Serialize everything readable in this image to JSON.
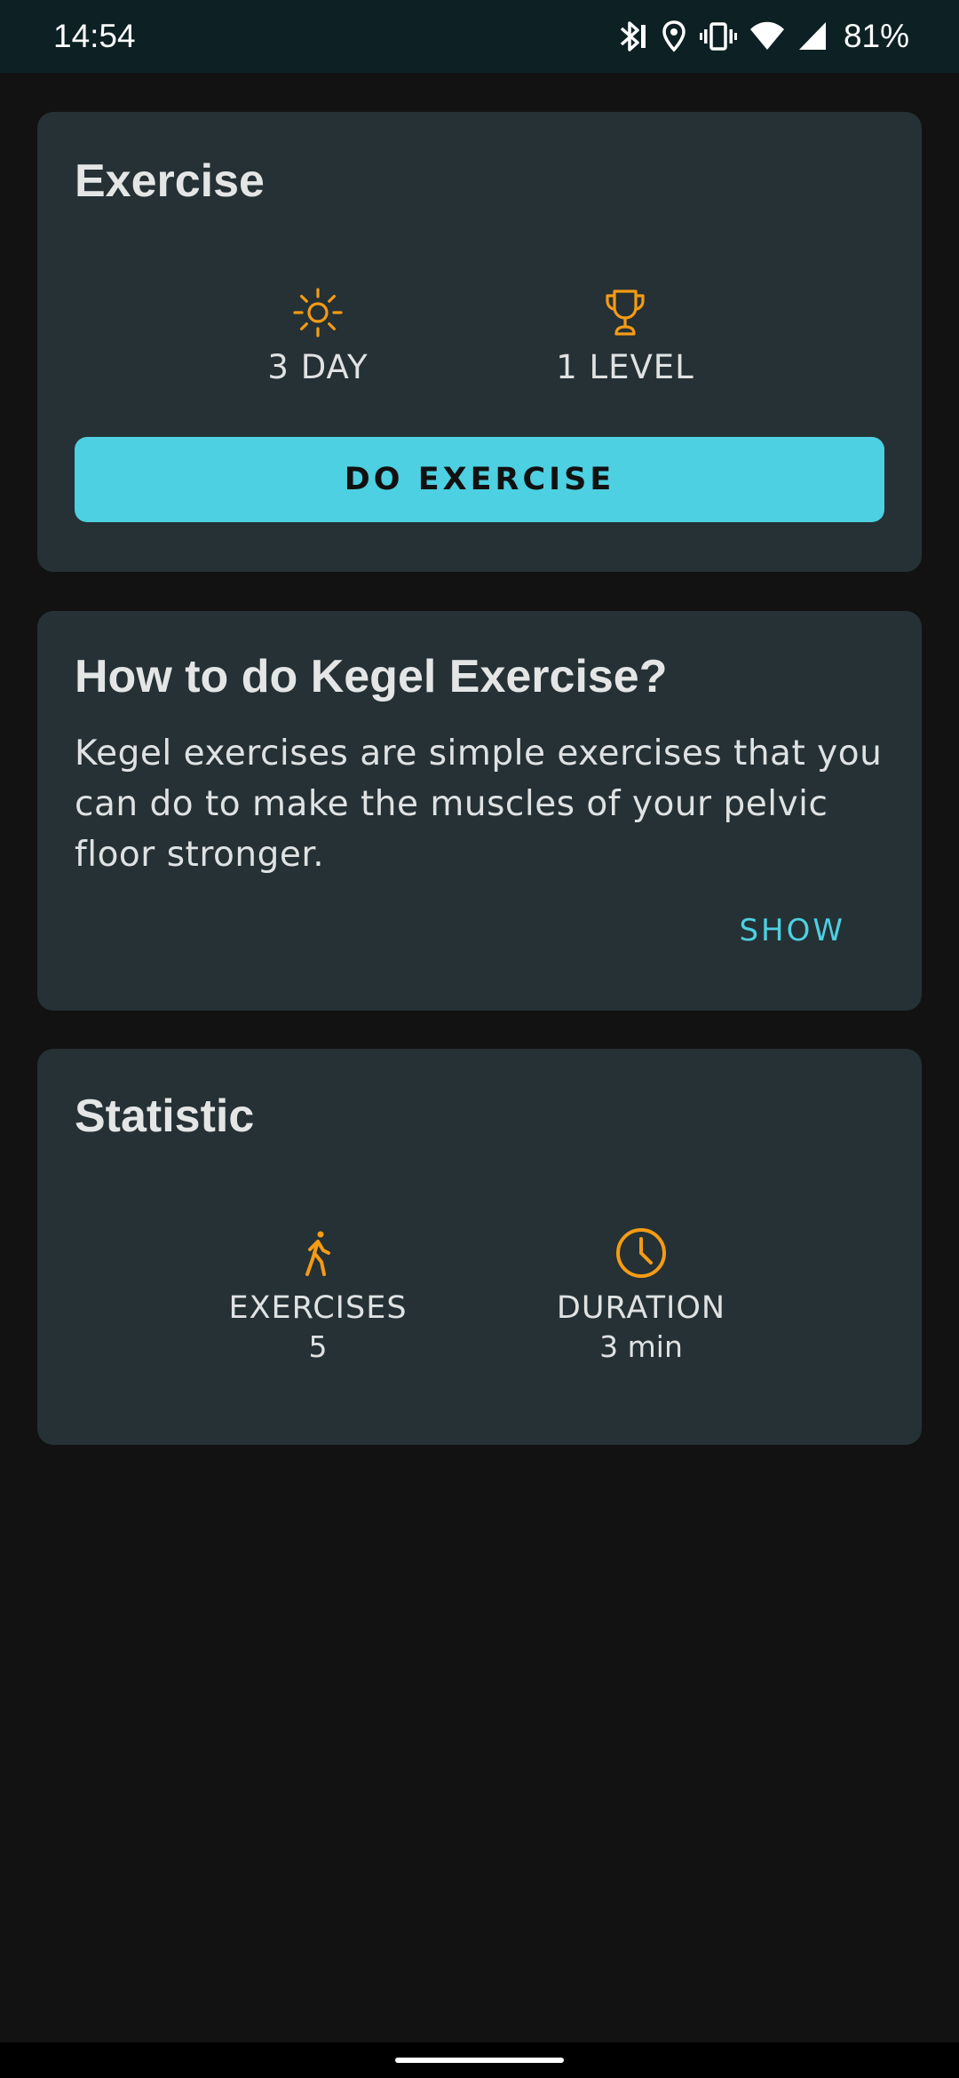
{
  "status_bar": {
    "time": "14:54",
    "battery": "81%",
    "icons": [
      "bluetooth-icon",
      "location-icon",
      "vibrate-icon",
      "wifi-icon",
      "signal-icon"
    ]
  },
  "exercise_card": {
    "title": "Exercise",
    "day": {
      "icon": "sun-icon",
      "label": "3 DAY"
    },
    "level": {
      "icon": "trophy-icon",
      "label": "1 LEVEL"
    },
    "button_label": "DO EXERCISE"
  },
  "howto_card": {
    "title": "How to do Kegel Exercise?",
    "text": "Kegel exercises are simple exercises that you can do to make the muscles of your pelvic floor stronger.",
    "show_label": "SHOW"
  },
  "statistic_card": {
    "title": "Statistic",
    "exercises": {
      "icon": "walking-person-icon",
      "label": "EXERCISES",
      "value": "5"
    },
    "duration": {
      "icon": "clock-icon",
      "label": "DURATION",
      "value": "3 min"
    }
  },
  "colors": {
    "accent": "#4dd0e1",
    "icon_orange": "#f59b14",
    "card_bg": "#253134",
    "page_bg": "#121212"
  }
}
